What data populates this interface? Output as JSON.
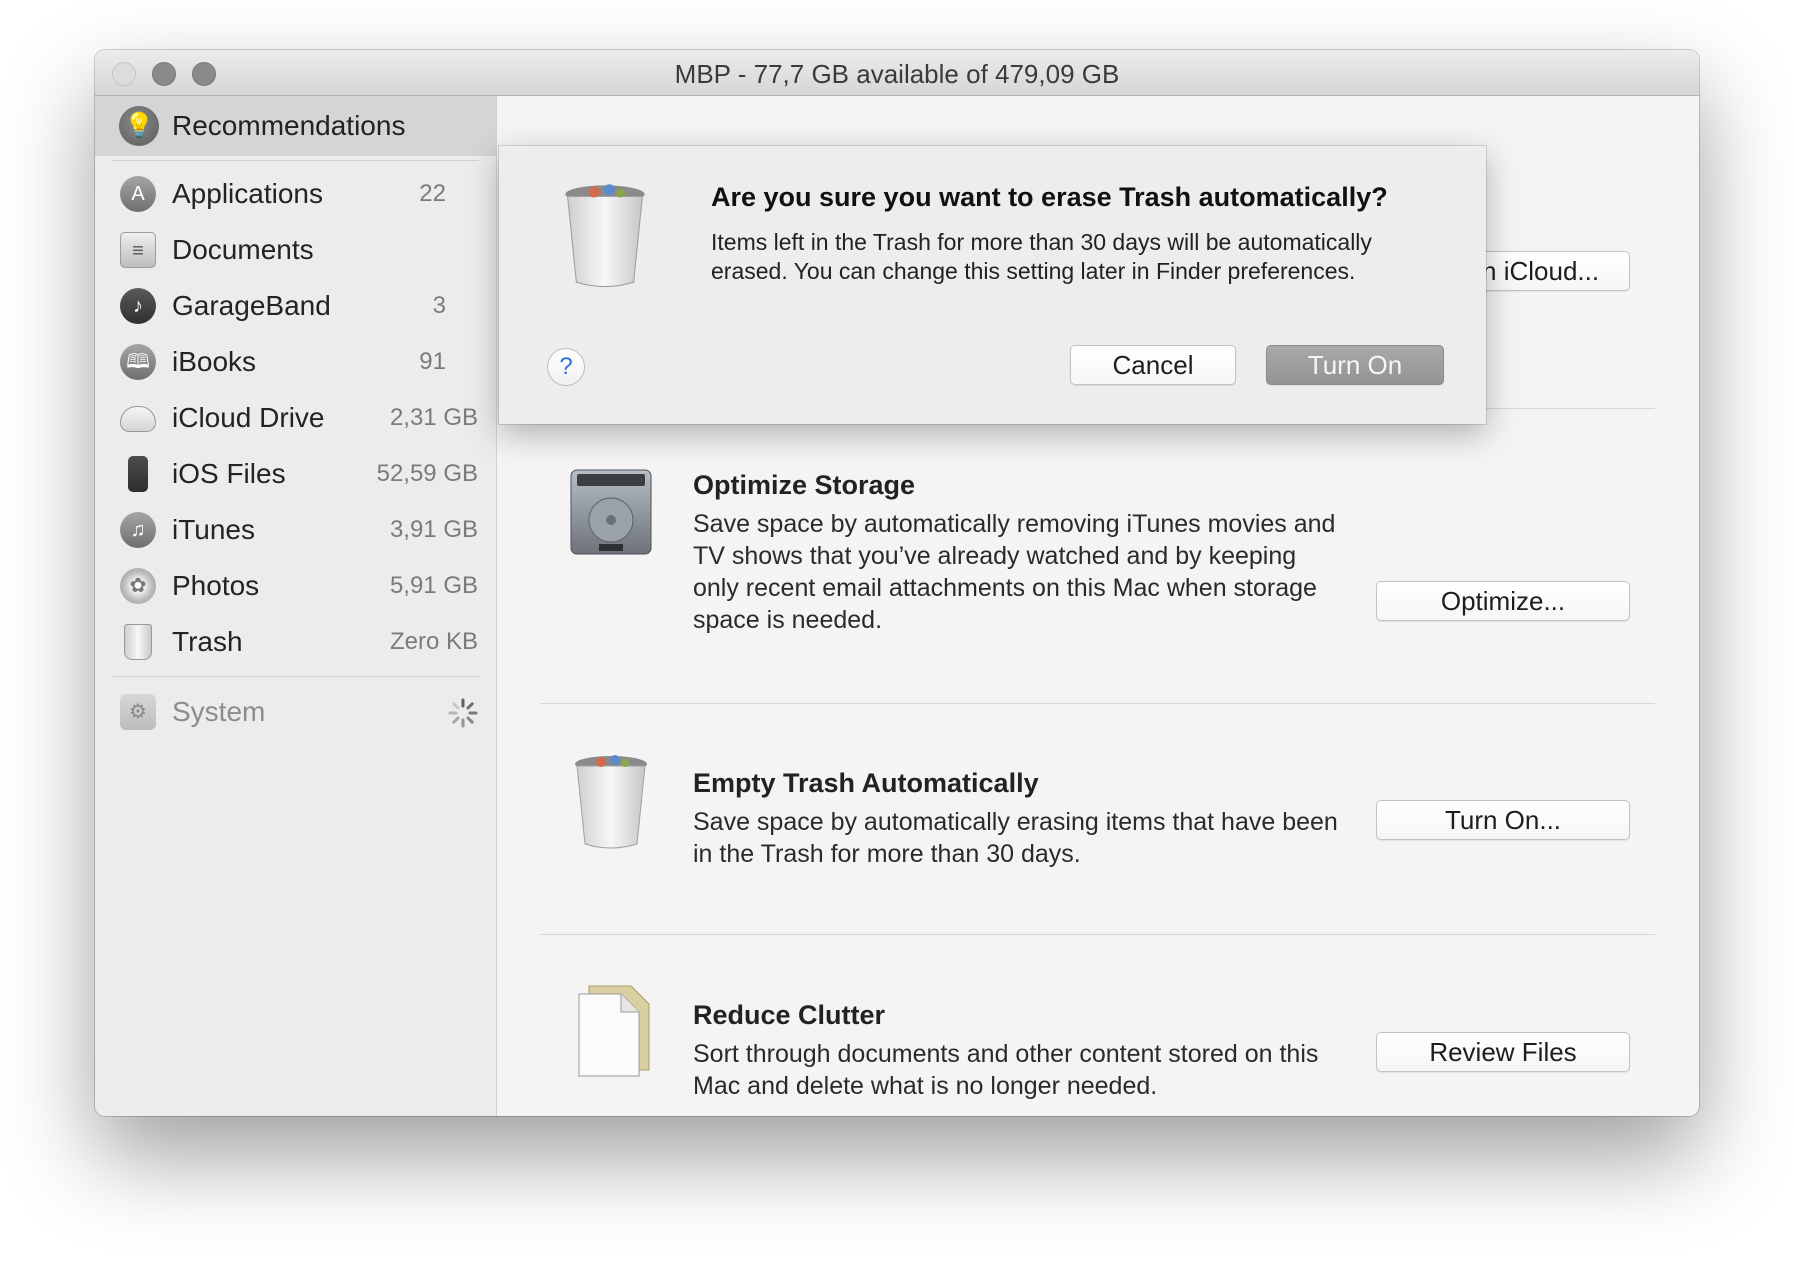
{
  "window": {
    "title": "MBP - 77,7 GB available of 479,09 GB"
  },
  "sidebar": {
    "recommendations_label": "Recommendations",
    "items": [
      {
        "label": "Applications",
        "size": "22",
        "icon": "applications-icon"
      },
      {
        "label": "Documents",
        "size": "",
        "icon": "documents-icon"
      },
      {
        "label": "GarageBand",
        "size": "3",
        "icon": "garageband-icon"
      },
      {
        "label": "iBooks",
        "size": "91",
        "icon": "ibooks-icon"
      },
      {
        "label": "iCloud Drive",
        "size": "2,31 GB",
        "icon": "cloud-icon"
      },
      {
        "label": "iOS Files",
        "size": "52,59 GB",
        "icon": "iphone-icon"
      },
      {
        "label": "iTunes",
        "size": "3,91 GB",
        "icon": "music-note-icon"
      },
      {
        "label": "Photos",
        "size": "5,91 GB",
        "icon": "photos-flower-icon"
      },
      {
        "label": "Trash",
        "size": "Zero KB",
        "icon": "trash-icon"
      }
    ],
    "system_label": "System"
  },
  "recommendations": {
    "store_in_icloud": {
      "button": "Store in iCloud..."
    },
    "optimize_storage": {
      "title": "Optimize Storage",
      "description": "Save space by automatically removing iTunes movies and TV shows that you’ve already watched and by keeping only recent email attachments on this Mac when storage space is needed.",
      "button": "Optimize..."
    },
    "empty_trash": {
      "title": "Empty Trash Automatically",
      "description": "Save space by automatically erasing items that have been in the Trash for more than 30 days.",
      "button": "Turn On..."
    },
    "reduce_clutter": {
      "title": "Reduce Clutter",
      "description": "Sort through documents and other content stored on this Mac and delete what is no longer needed.",
      "button": "Review Files"
    }
  },
  "dialog": {
    "title": "Are you sure you want to erase Trash automatically?",
    "message": "Items left in the Trash for more than 30 days will be automatically erased. You can change this setting later in Finder preferences.",
    "help": "?",
    "cancel": "Cancel",
    "confirm": "Turn On"
  },
  "colors": {
    "default_button": "#9d9d9d",
    "help_icon": "#2f72d6"
  }
}
